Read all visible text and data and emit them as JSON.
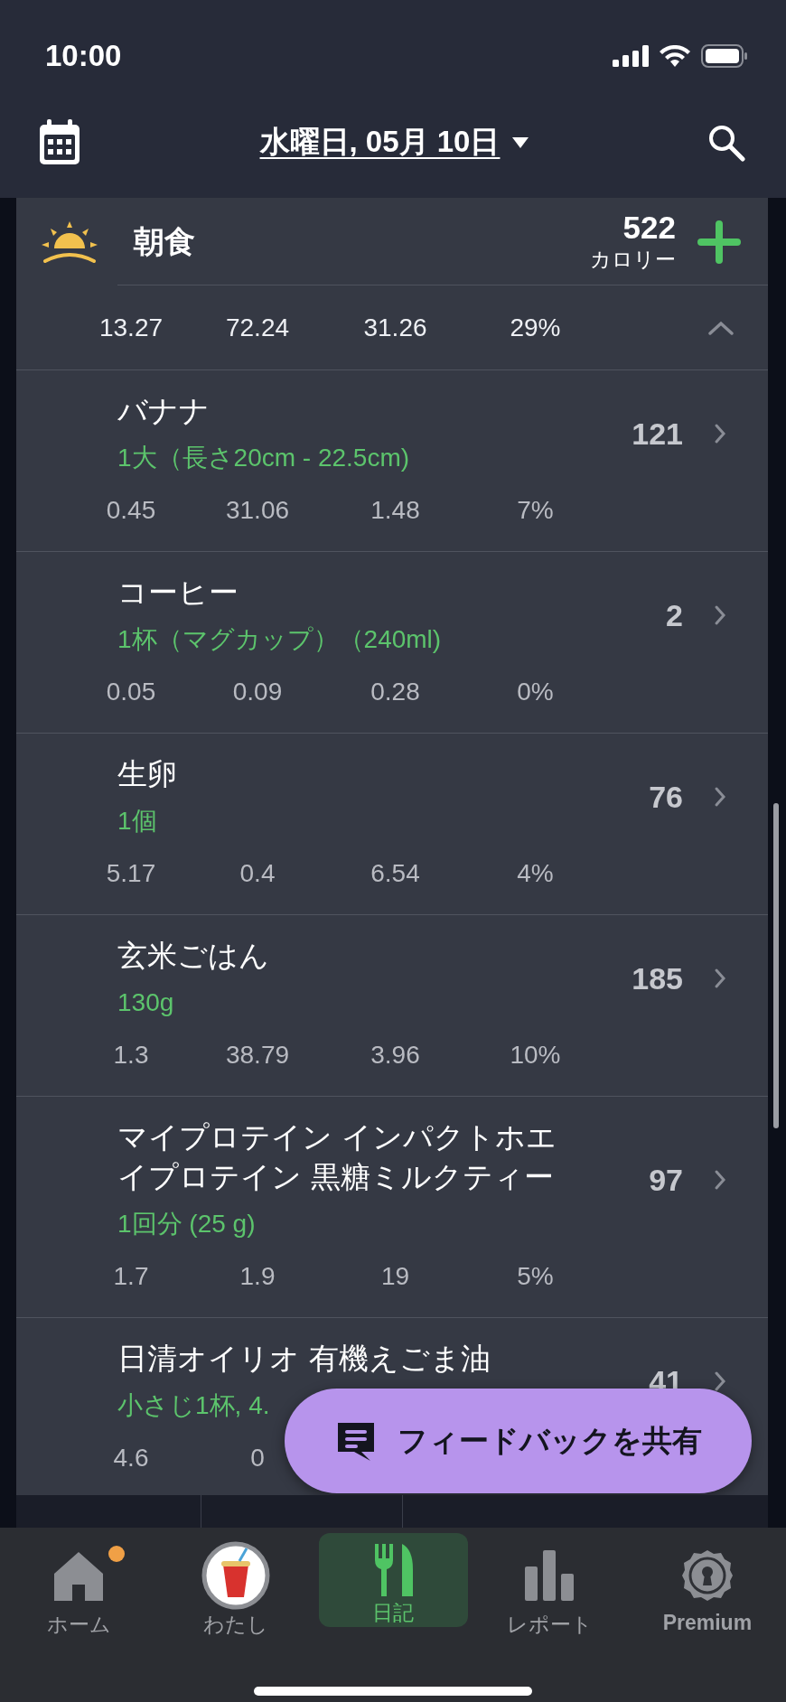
{
  "status_bar": {
    "time": "10:00"
  },
  "header": {
    "date": "水曜日, 05月 10日"
  },
  "meal": {
    "name": "朝食",
    "calories": "522",
    "calories_unit": "カロリー",
    "totals": [
      "13.27",
      "72.24",
      "31.26",
      "29%"
    ],
    "expanded": true
  },
  "foods": [
    {
      "name": "バナナ",
      "serving": "1大（長さ20cm - 22.5cm)",
      "calories": "121",
      "macros": [
        "0.45",
        "31.06",
        "1.48",
        "7%"
      ]
    },
    {
      "name": "コーヒー",
      "serving": "1杯（マグカップ）（240ml)",
      "calories": "2",
      "macros": [
        "0.05",
        "0.09",
        "0.28",
        "0%"
      ]
    },
    {
      "name": "生卵",
      "serving": "1個",
      "calories": "76",
      "macros": [
        "5.17",
        "0.4",
        "6.54",
        "4%"
      ]
    },
    {
      "name": "玄米ごはん",
      "serving": "130g",
      "calories": "185",
      "macros": [
        "1.3",
        "38.79",
        "3.96",
        "10%"
      ]
    },
    {
      "name": "マイプロテイン インパクトホエイプロテイン 黒糖ミルクティー",
      "serving": "1回分 (25 g)",
      "calories": "97",
      "macros": [
        "1.7",
        "1.9",
        "19",
        "5%"
      ]
    },
    {
      "name": "日清オイリオ 有機えごま油",
      "serving": "小さじ1杯, 4.",
      "calories": "41",
      "macros": [
        "4.6",
        "0"
      ]
    }
  ],
  "feedback_button": {
    "label": "フィードバックを共有"
  },
  "tabs": [
    {
      "kind": "home",
      "label": "ホーム",
      "selected": false,
      "badge": true
    },
    {
      "kind": "avatar",
      "label": "わたし",
      "selected": false,
      "badge": false
    },
    {
      "kind": "diary",
      "label": "日記",
      "selected": true,
      "badge": false
    },
    {
      "kind": "report",
      "label": "レポート",
      "selected": false,
      "badge": false
    },
    {
      "kind": "premium",
      "label": "Premium",
      "selected": false,
      "badge": false
    }
  ]
}
